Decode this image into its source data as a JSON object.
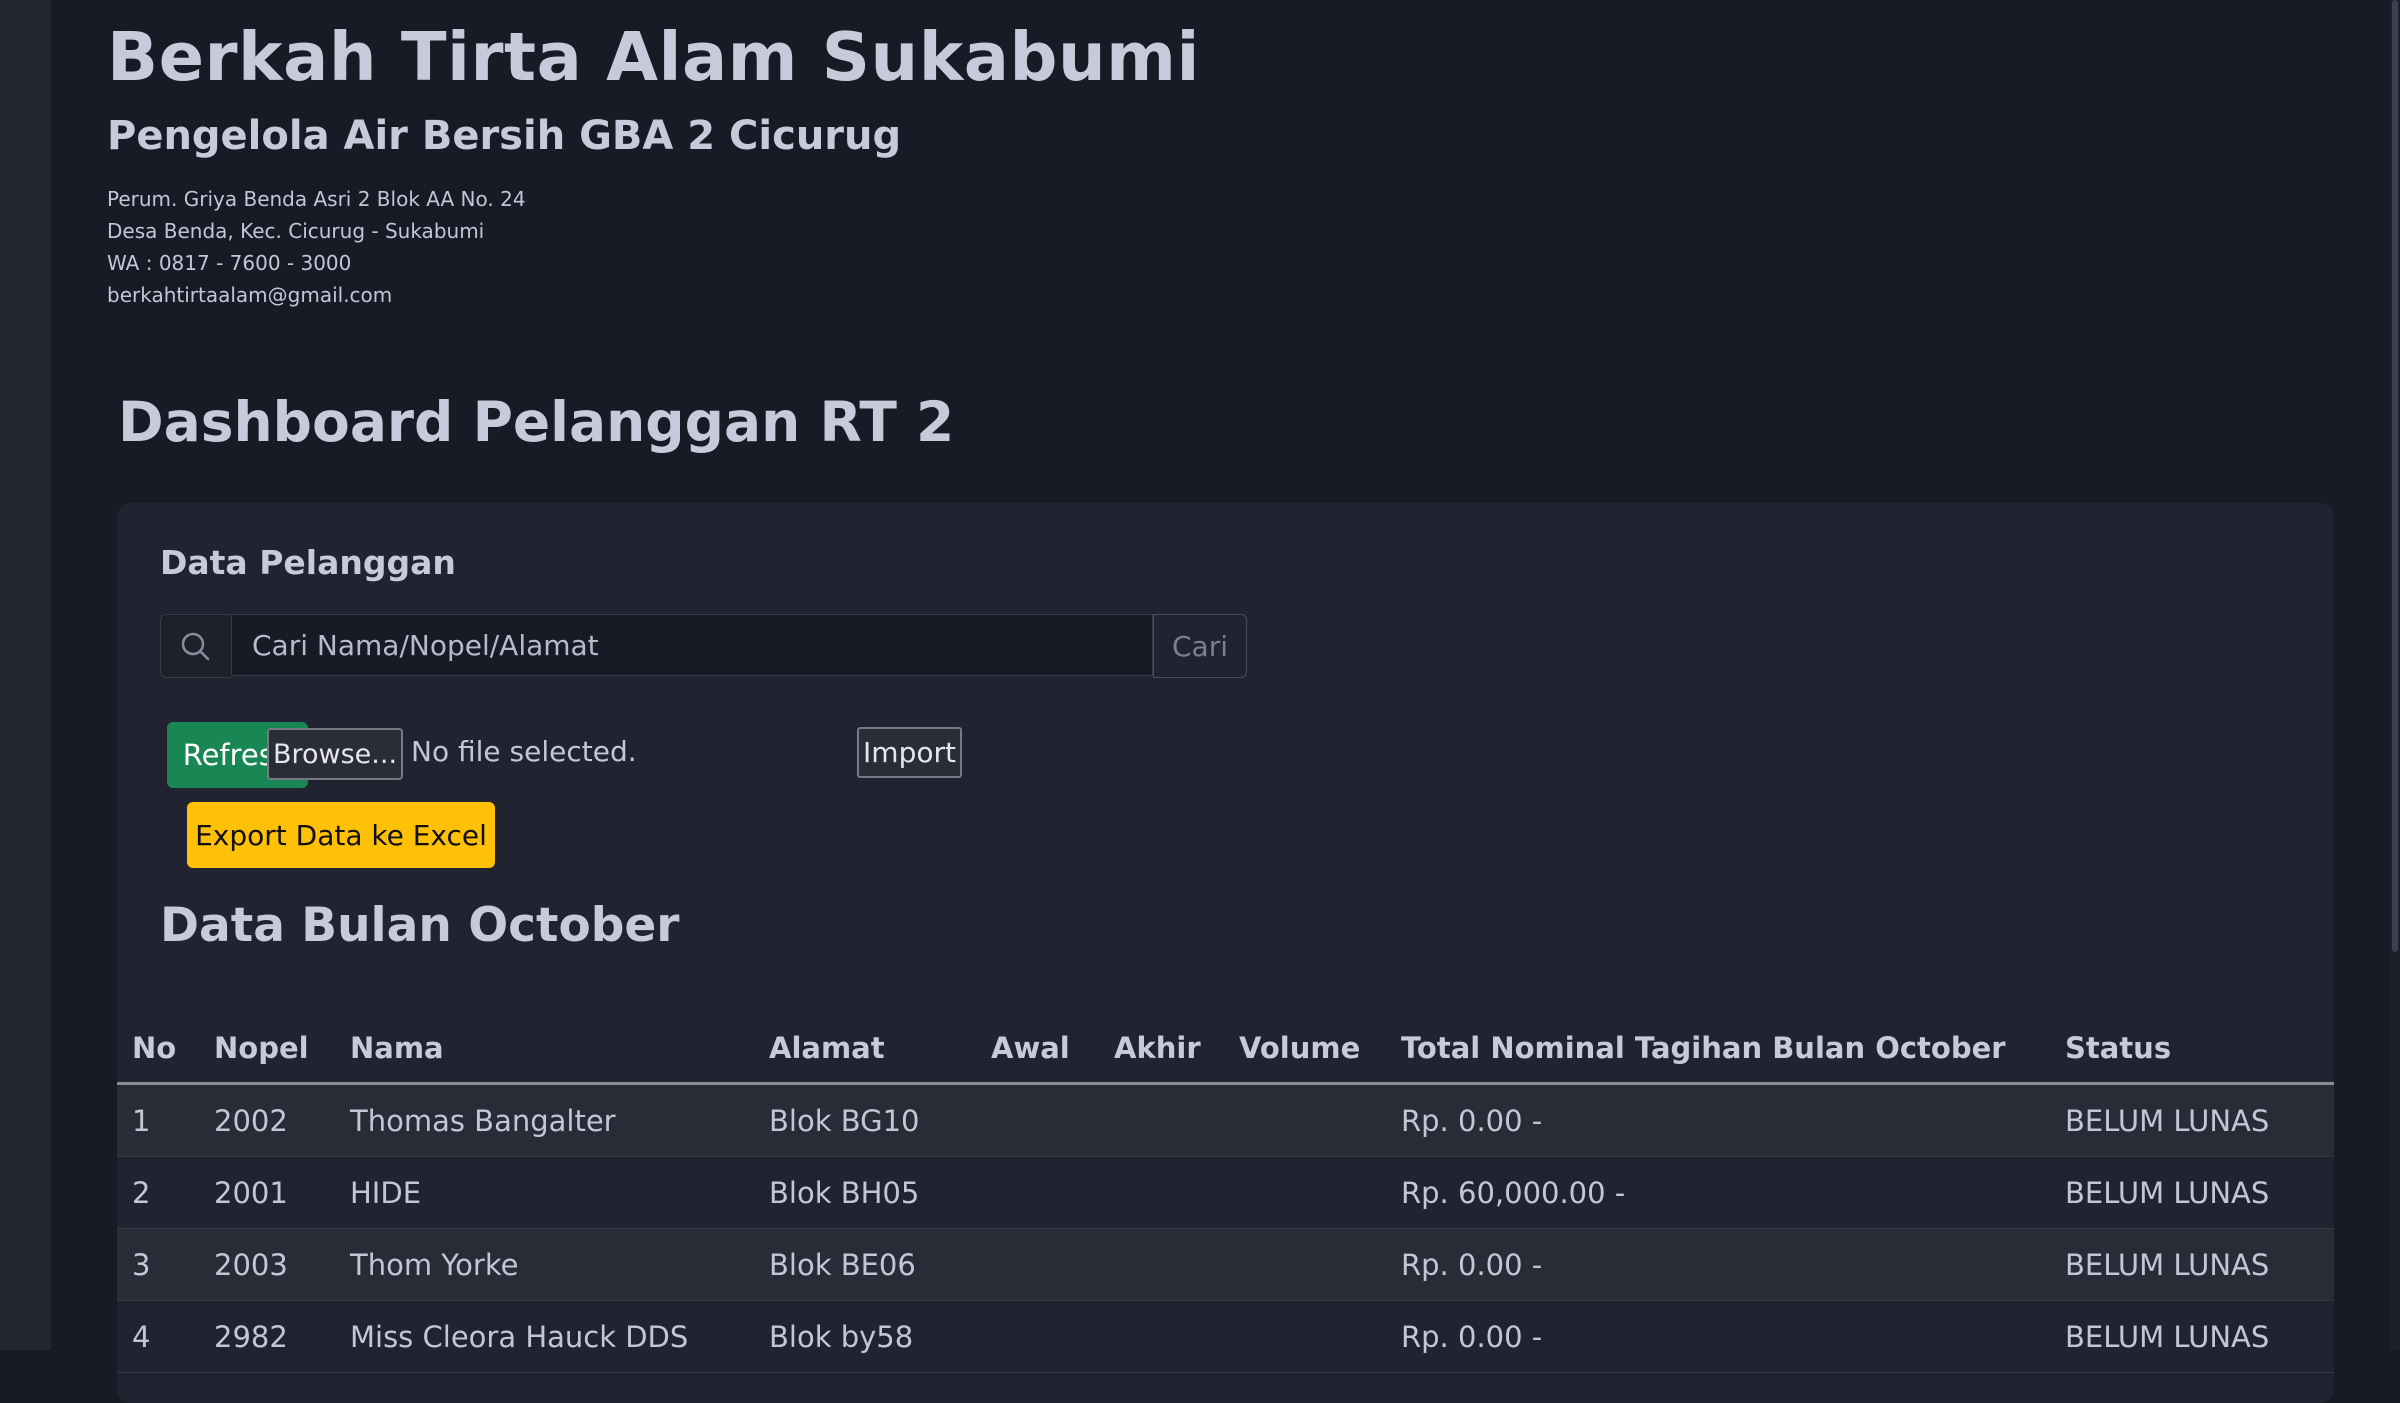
{
  "header": {
    "title": "Berkah Tirta Alam Sukabumi",
    "subtitle": "Pengelola Air Bersih GBA 2 Cicurug",
    "address_lines": [
      "Perum. Griya Benda Asri 2 Blok AA No. 24",
      "Desa Benda, Kec. Cicurug - Sukabumi",
      "WA : 0817 - 7600 - 3000",
      "berkahtirtaalam@gmail.com"
    ]
  },
  "dashboard": {
    "title": "Dashboard Pelanggan RT 2"
  },
  "card": {
    "title": "Data Pelanggan",
    "search": {
      "icon": "search-icon",
      "value": "",
      "placeholder": "Cari Nama/Nopel/Alamat",
      "button_label": "Cari"
    },
    "refresh_label": "Refresh",
    "file_input": {
      "browse_label": "Browse...",
      "status": "No file selected."
    },
    "import_label": "Import",
    "export_label": "Export Data ke Excel",
    "month_title": "Data Bulan October"
  },
  "table": {
    "headers": [
      "No",
      "Nopel",
      "Nama",
      "Alamat",
      "Awal",
      "Akhir",
      "Volume",
      "Total Nominal Tagihan Bulan October",
      "Status"
    ],
    "rows": [
      [
        "1",
        "2002",
        "Thomas Bangalter",
        "Blok BG10",
        "",
        "",
        "",
        "Rp. 0.00 -",
        "BELUM LUNAS"
      ],
      [
        "2",
        "2001",
        "HIDE",
        "Blok BH05",
        "",
        "",
        "",
        "Rp. 60,000.00 -",
        "BELUM LUNAS"
      ],
      [
        "3",
        "2003",
        "Thom Yorke",
        "Blok BE06",
        "",
        "",
        "",
        "Rp. 0.00 -",
        "BELUM LUNAS"
      ],
      [
        "4",
        "2982",
        "Miss Cleora Hauck DDS",
        "Blok by58",
        "",
        "",
        "",
        "Rp. 0.00 -",
        "BELUM LUNAS"
      ]
    ]
  },
  "colors": {
    "background": "#181a25",
    "card": "#212330",
    "refresh_button": "#198754",
    "export_button": "#ffc107"
  }
}
